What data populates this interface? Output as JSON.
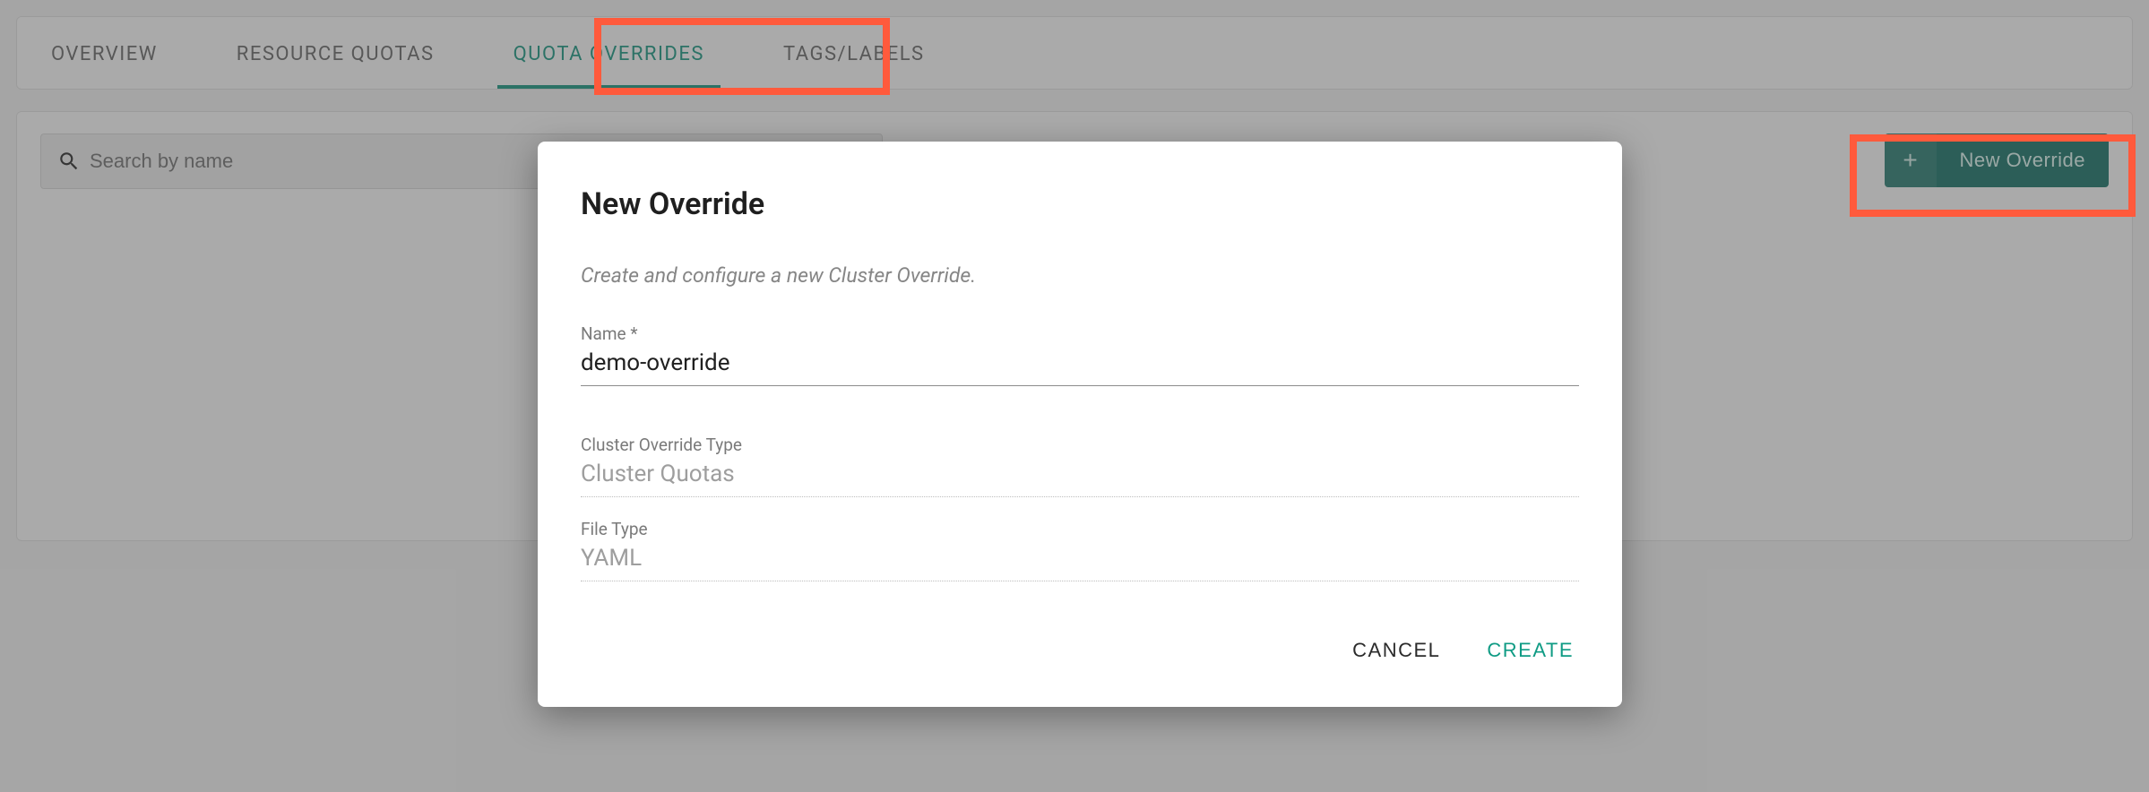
{
  "tabs": {
    "overview": "OVERVIEW",
    "resource_quotas": "RESOURCE QUOTAS",
    "quota_overrides": "QUOTA OVERRIDES",
    "tags_labels": "TAGS/LABELS"
  },
  "search": {
    "placeholder": "Search by name"
  },
  "new_override_button": {
    "label": "New Override"
  },
  "modal": {
    "title": "New Override",
    "subtitle": "Create and configure a new Cluster Override.",
    "fields": {
      "name": {
        "label": "Name *",
        "value": "demo-override"
      },
      "override_type": {
        "label": "Cluster Override Type",
        "value": "Cluster Quotas"
      },
      "file_type": {
        "label": "File Type",
        "value": "YAML"
      }
    },
    "actions": {
      "cancel": "CANCEL",
      "create": "CREATE"
    }
  },
  "colors": {
    "accent": "#0f8e78",
    "highlight": "#ff5a3c"
  }
}
